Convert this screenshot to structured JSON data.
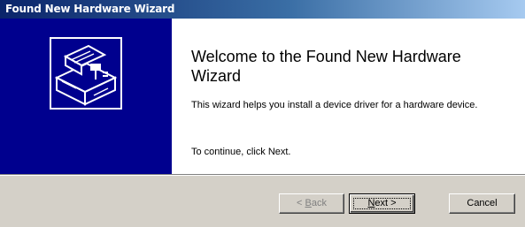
{
  "window": {
    "title": "Found New Hardware Wizard"
  },
  "content": {
    "heading": "Welcome to the Found New Hardware Wizard",
    "description": "This wizard helps you install a device driver for a hardware device.",
    "instruction": "To continue, click Next."
  },
  "sidebar": {
    "icon": "hardware-wizard-icon",
    "background_color": "#00008e"
  },
  "buttons": {
    "back": {
      "label_prefix": "< ",
      "label_hotkey": "B",
      "label_rest": "ack",
      "enabled": false
    },
    "next": {
      "label_hotkey": "N",
      "label_rest": "ext >",
      "enabled": true,
      "default": true
    },
    "cancel": {
      "label": "Cancel",
      "enabled": true
    }
  }
}
